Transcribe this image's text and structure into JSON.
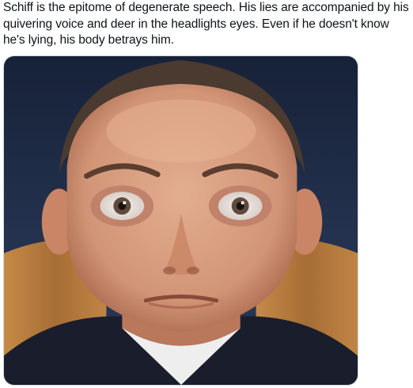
{
  "tweet": {
    "text": "Schiff is the epitome of degenerate speech. His lies are accompanied by his\nquivering voice and deer in the headlights eyes. Even if he doesn't know\nhe's lying, his body betrays him."
  },
  "media": {
    "alt": "Close-up photo of a man with wide eyes",
    "colors": {
      "background_dark": "#1d2a44",
      "wood_panel": "#b07a3e",
      "skin": "#d9a184",
      "skin_shadow": "#b9775c",
      "hair": "#4a3a30",
      "suit": "#1a1e2c",
      "shirt": "#f2f2f2"
    }
  }
}
